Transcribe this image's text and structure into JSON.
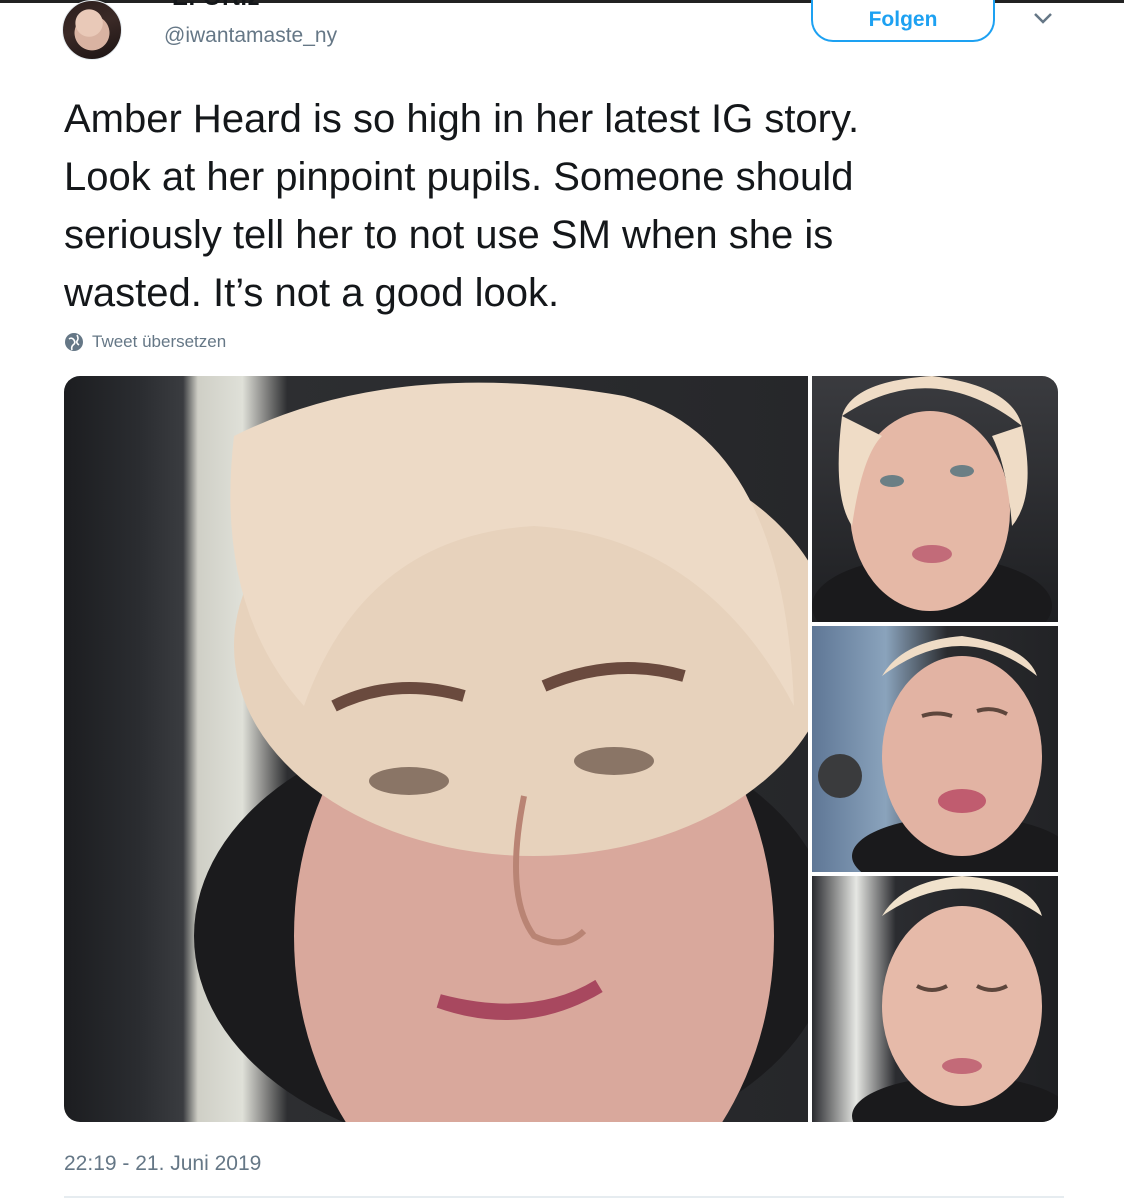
{
  "tweet": {
    "display_name": "E. Ortiz",
    "handle": "@iwantamaste_ny",
    "follow_label": "Folgen",
    "text": "Amber Heard is so high in her latest IG story.\nLook at her pinpoint pupils. Someone should\nseriously tell her to not use SM when she is\nwasted. It’s not a good look.",
    "translate_label": "Tweet übersetzen",
    "timestamp": "22:19 - 21. Juni 2019"
  },
  "icons": {
    "more": "chevron-down-icon",
    "translate": "globe-icon"
  },
  "colors": {
    "accent": "#1da1f2",
    "secondary_text": "#657786",
    "primary_text": "#14171a"
  }
}
